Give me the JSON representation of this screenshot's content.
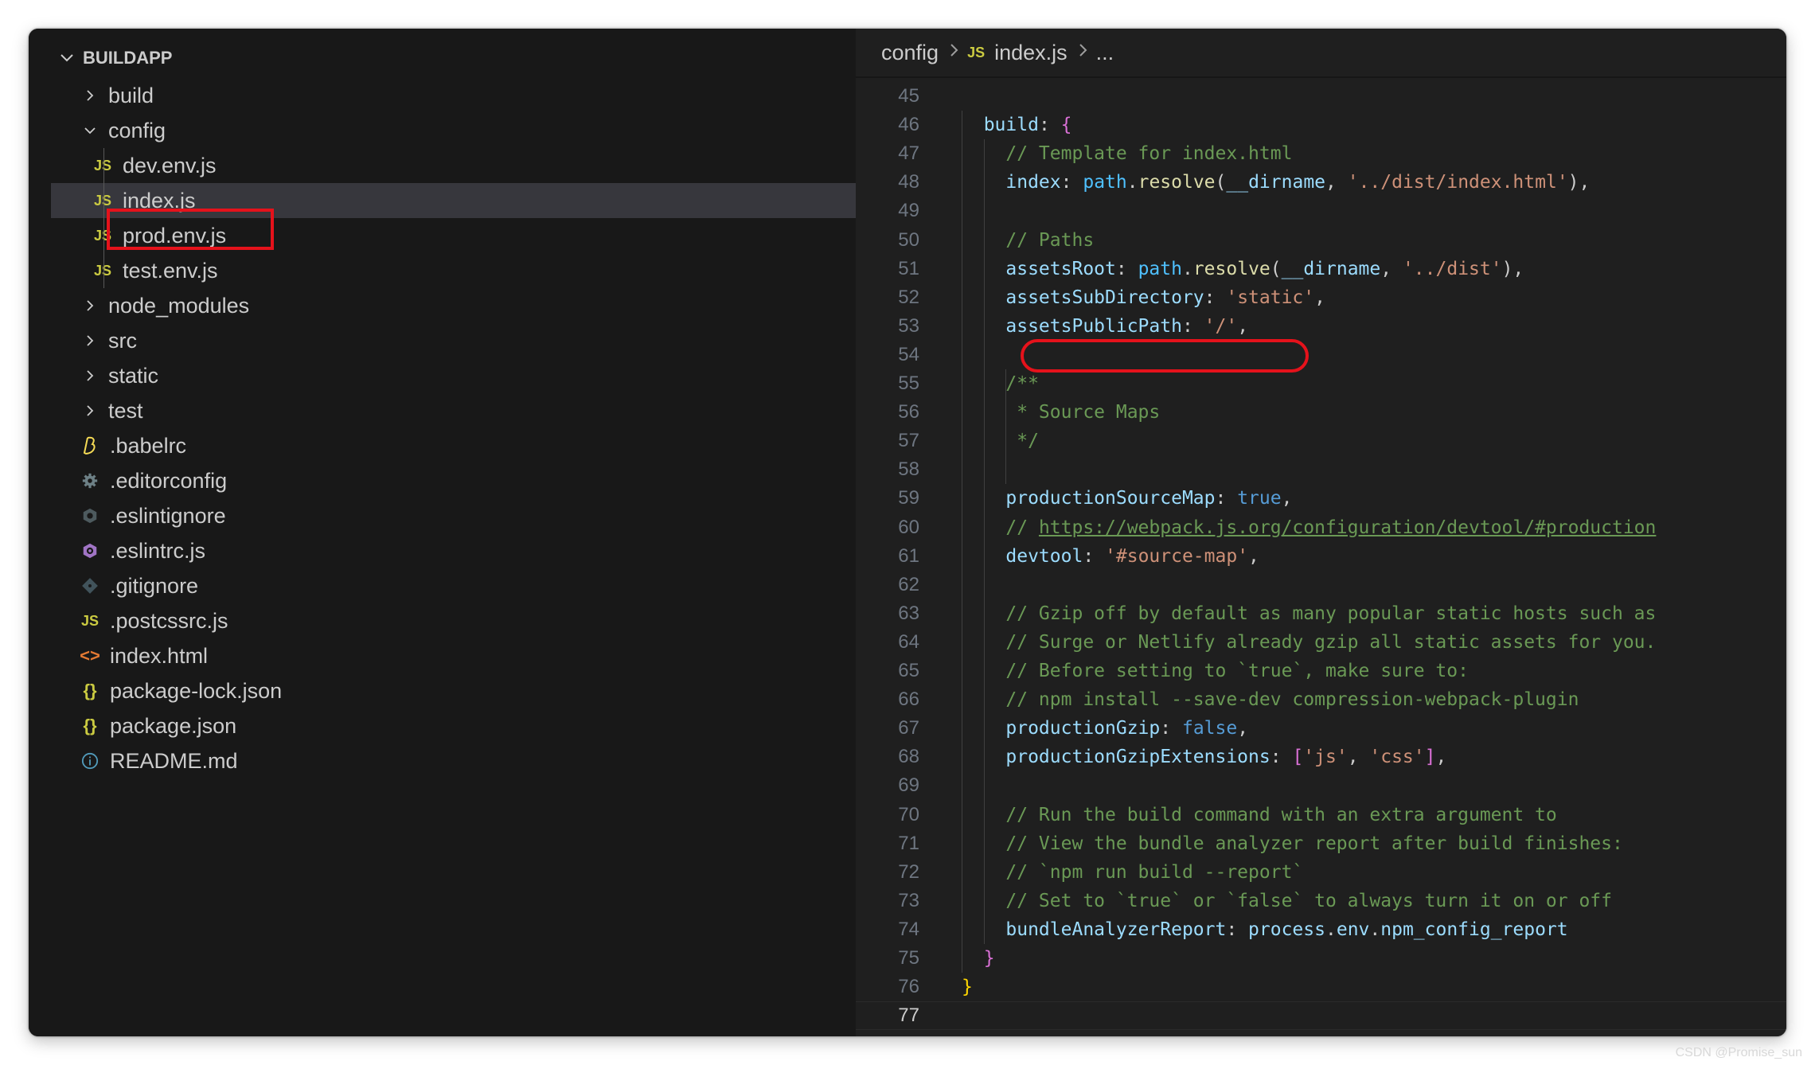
{
  "explorer": {
    "title": "BUILDAPP",
    "items": [
      {
        "label": "build",
        "kind": "folder",
        "expanded": false,
        "depth": 0
      },
      {
        "label": "config",
        "kind": "folder",
        "expanded": true,
        "depth": 0
      },
      {
        "label": "dev.env.js",
        "kind": "js",
        "depth": 1
      },
      {
        "label": "index.js",
        "kind": "js",
        "depth": 1,
        "selected": true
      },
      {
        "label": "prod.env.js",
        "kind": "js",
        "depth": 1
      },
      {
        "label": "test.env.js",
        "kind": "js",
        "depth": 1
      },
      {
        "label": "node_modules",
        "kind": "folder",
        "expanded": false,
        "depth": 0
      },
      {
        "label": "src",
        "kind": "folder",
        "expanded": false,
        "depth": 0
      },
      {
        "label": "static",
        "kind": "folder",
        "expanded": false,
        "depth": 0
      },
      {
        "label": "test",
        "kind": "folder",
        "expanded": false,
        "depth": 0
      },
      {
        "label": ".babelrc",
        "kind": "babel",
        "depth": 0
      },
      {
        "label": ".editorconfig",
        "kind": "gear",
        "depth": 0
      },
      {
        "label": ".eslintignore",
        "kind": "eslint-gray",
        "depth": 0
      },
      {
        "label": ".eslintrc.js",
        "kind": "eslint",
        "depth": 0
      },
      {
        "label": ".gitignore",
        "kind": "git",
        "depth": 0
      },
      {
        "label": ".postcssrc.js",
        "kind": "js",
        "depth": 0
      },
      {
        "label": "index.html",
        "kind": "html",
        "depth": 0
      },
      {
        "label": "package-lock.json",
        "kind": "json",
        "depth": 0
      },
      {
        "label": "package.json",
        "kind": "json",
        "depth": 0
      },
      {
        "label": "README.md",
        "kind": "info",
        "depth": 0
      }
    ]
  },
  "icon_glyphs": {
    "js": "JS",
    "json": "{}",
    "html": "<>"
  },
  "breadcrumb": {
    "folder": "config",
    "file_icon": "JS",
    "file": "index.js",
    "more": "..."
  },
  "editor": {
    "current_line": 77,
    "lines": [
      {
        "n": 45,
        "indent": 0,
        "tokens": []
      },
      {
        "n": 46,
        "indent": 1,
        "tokens": [
          {
            "t": "build",
            "c": "k-prop"
          },
          {
            "t": ": ",
            "c": "k-punc"
          },
          {
            "t": "{",
            "c": "k-brace1"
          }
        ]
      },
      {
        "n": 47,
        "indent": 2,
        "tokens": [
          {
            "t": "// Template for index.html",
            "c": "k-com"
          }
        ]
      },
      {
        "n": 48,
        "indent": 2,
        "tokens": [
          {
            "t": "index",
            "c": "k-prop"
          },
          {
            "t": ": ",
            "c": "k-punc"
          },
          {
            "t": "path",
            "c": "k-var"
          },
          {
            "t": ".",
            "c": "k-punc"
          },
          {
            "t": "resolve",
            "c": "k-fn"
          },
          {
            "t": "(",
            "c": "k-punc"
          },
          {
            "t": "__dirname",
            "c": "k-prop"
          },
          {
            "t": ", ",
            "c": "k-punc"
          },
          {
            "t": "'../dist/index.html'",
            "c": "k-str"
          },
          {
            "t": "),",
            "c": "k-punc"
          }
        ]
      },
      {
        "n": 49,
        "indent": 0,
        "tokens": []
      },
      {
        "n": 50,
        "indent": 2,
        "tokens": [
          {
            "t": "// Paths",
            "c": "k-com"
          }
        ]
      },
      {
        "n": 51,
        "indent": 2,
        "tokens": [
          {
            "t": "assetsRoot",
            "c": "k-prop"
          },
          {
            "t": ": ",
            "c": "k-punc"
          },
          {
            "t": "path",
            "c": "k-var"
          },
          {
            "t": ".",
            "c": "k-punc"
          },
          {
            "t": "resolve",
            "c": "k-fn"
          },
          {
            "t": "(",
            "c": "k-punc"
          },
          {
            "t": "__dirname",
            "c": "k-prop"
          },
          {
            "t": ", ",
            "c": "k-punc"
          },
          {
            "t": "'../dist'",
            "c": "k-str"
          },
          {
            "t": "),",
            "c": "k-punc"
          }
        ]
      },
      {
        "n": 52,
        "indent": 2,
        "tokens": [
          {
            "t": "assetsSubDirectory",
            "c": "k-prop"
          },
          {
            "t": ": ",
            "c": "k-punc"
          },
          {
            "t": "'static'",
            "c": "k-str"
          },
          {
            "t": ",",
            "c": "k-punc"
          }
        ]
      },
      {
        "n": 53,
        "indent": 2,
        "tokens": [
          {
            "t": "assetsPublicPath",
            "c": "k-prop"
          },
          {
            "t": ": ",
            "c": "k-punc"
          },
          {
            "t": "'/'",
            "c": "k-str"
          },
          {
            "t": ",",
            "c": "k-punc"
          }
        ]
      },
      {
        "n": 54,
        "indent": 0,
        "tokens": []
      },
      {
        "n": 55,
        "indent": 2,
        "tokens": [
          {
            "t": "/**",
            "c": "k-com"
          }
        ]
      },
      {
        "n": 56,
        "indent": 2,
        "tokens": [
          {
            "t": " * Source Maps",
            "c": "k-com"
          }
        ]
      },
      {
        "n": 57,
        "indent": 2,
        "tokens": [
          {
            "t": " */",
            "c": "k-com"
          }
        ]
      },
      {
        "n": 58,
        "indent": 0,
        "tokens": []
      },
      {
        "n": 59,
        "indent": 2,
        "tokens": [
          {
            "t": "productionSourceMap",
            "c": "k-prop"
          },
          {
            "t": ": ",
            "c": "k-punc"
          },
          {
            "t": "true",
            "c": "k-bool"
          },
          {
            "t": ",",
            "c": "k-punc"
          }
        ]
      },
      {
        "n": 60,
        "indent": 2,
        "tokens": [
          {
            "t": "// ",
            "c": "k-com"
          },
          {
            "t": "https://webpack.js.org/configuration/devtool/#production",
            "c": "k-link"
          }
        ]
      },
      {
        "n": 61,
        "indent": 2,
        "tokens": [
          {
            "t": "devtool",
            "c": "k-prop"
          },
          {
            "t": ": ",
            "c": "k-punc"
          },
          {
            "t": "'#source-map'",
            "c": "k-str"
          },
          {
            "t": ",",
            "c": "k-punc"
          }
        ]
      },
      {
        "n": 62,
        "indent": 0,
        "tokens": []
      },
      {
        "n": 63,
        "indent": 2,
        "tokens": [
          {
            "t": "// Gzip off by default as many popular static hosts such as",
            "c": "k-com"
          }
        ]
      },
      {
        "n": 64,
        "indent": 2,
        "tokens": [
          {
            "t": "// Surge or Netlify already gzip all static assets for you.",
            "c": "k-com"
          }
        ]
      },
      {
        "n": 65,
        "indent": 2,
        "tokens": [
          {
            "t": "// Before setting to `true`, make sure to:",
            "c": "k-com"
          }
        ]
      },
      {
        "n": 66,
        "indent": 2,
        "tokens": [
          {
            "t": "// npm install --save-dev compression-webpack-plugin",
            "c": "k-com"
          }
        ]
      },
      {
        "n": 67,
        "indent": 2,
        "tokens": [
          {
            "t": "productionGzip",
            "c": "k-prop"
          },
          {
            "t": ": ",
            "c": "k-punc"
          },
          {
            "t": "false",
            "c": "k-bool"
          },
          {
            "t": ",",
            "c": "k-punc"
          }
        ]
      },
      {
        "n": 68,
        "indent": 2,
        "tokens": [
          {
            "t": "productionGzipExtensions",
            "c": "k-prop"
          },
          {
            "t": ": ",
            "c": "k-punc"
          },
          {
            "t": "[",
            "c": "k-brace1"
          },
          {
            "t": "'js'",
            "c": "k-str"
          },
          {
            "t": ", ",
            "c": "k-punc"
          },
          {
            "t": "'css'",
            "c": "k-str"
          },
          {
            "t": "]",
            "c": "k-brace1"
          },
          {
            "t": ",",
            "c": "k-punc"
          }
        ]
      },
      {
        "n": 69,
        "indent": 0,
        "tokens": []
      },
      {
        "n": 70,
        "indent": 2,
        "tokens": [
          {
            "t": "// Run the build command with an extra argument to",
            "c": "k-com"
          }
        ]
      },
      {
        "n": 71,
        "indent": 2,
        "tokens": [
          {
            "t": "// View the bundle analyzer report after build finishes:",
            "c": "k-com"
          }
        ]
      },
      {
        "n": 72,
        "indent": 2,
        "tokens": [
          {
            "t": "// `npm run build --report`",
            "c": "k-com"
          }
        ]
      },
      {
        "n": 73,
        "indent": 2,
        "tokens": [
          {
            "t": "// Set to `true` or `false` to always turn it on or off",
            "c": "k-com"
          }
        ]
      },
      {
        "n": 74,
        "indent": 2,
        "tokens": [
          {
            "t": "bundleAnalyzerReport",
            "c": "k-prop"
          },
          {
            "t": ": ",
            "c": "k-punc"
          },
          {
            "t": "process",
            "c": "k-prop"
          },
          {
            "t": ".",
            "c": "k-punc"
          },
          {
            "t": "env",
            "c": "k-prop"
          },
          {
            "t": ".",
            "c": "k-punc"
          },
          {
            "t": "npm_config_report",
            "c": "k-prop"
          }
        ]
      },
      {
        "n": 75,
        "indent": 1,
        "tokens": [
          {
            "t": "}",
            "c": "k-brace1"
          }
        ]
      },
      {
        "n": 76,
        "indent": 0,
        "tokens": [
          {
            "t": "}",
            "c": "k-brace0"
          }
        ]
      },
      {
        "n": 77,
        "indent": 0,
        "tokens": []
      }
    ]
  },
  "annotations": {
    "highlighted_file": "index.js",
    "highlighted_code": "assetsPublicPath: '/',"
  },
  "watermark": "CSDN @Promise_sun"
}
